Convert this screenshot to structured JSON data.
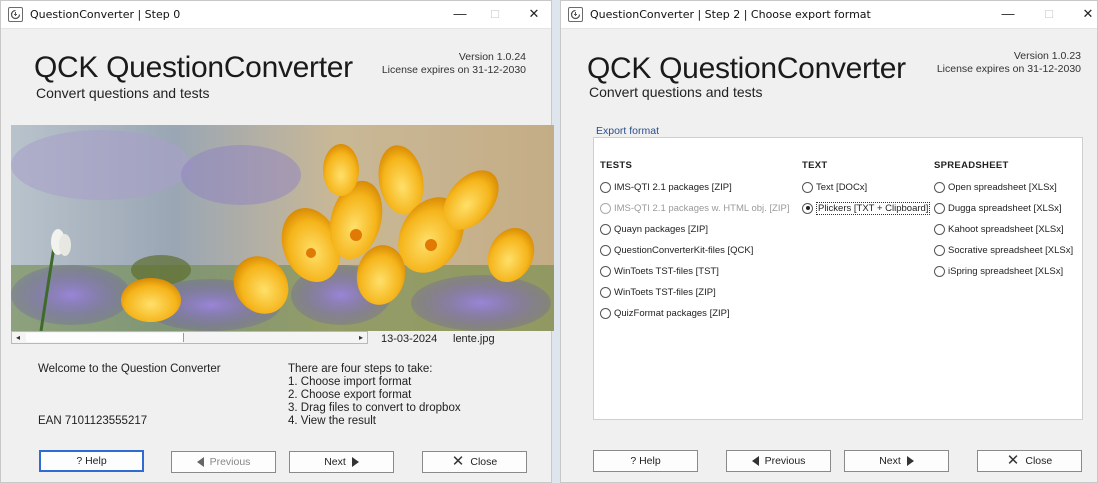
{
  "left": {
    "title": "QuestionConverter | Step 0",
    "controls": {
      "minimize": "—",
      "maximize": "□",
      "close": "✕"
    },
    "brand": "QCK QuestionConverter",
    "subtitle": "Convert questions and tests",
    "version": "Version 1.0.24",
    "license": "License expires on 31-12-2030",
    "image_date": "13-03-2024",
    "image_name": "lente.jpg",
    "welcome": "Welcome to the Question Converter",
    "ean": "EAN 7101123555217",
    "steps": [
      "There are four steps to take:",
      "1. Choose import format",
      "2. Choose export format",
      "3. Drag files to convert to dropbox",
      "4. View the result"
    ],
    "buttons": {
      "help": "? Help",
      "previous": "Previous",
      "next": "Next",
      "close": "Close"
    }
  },
  "right": {
    "title": "QuestionConverter | Step 2 | Choose export format",
    "controls": {
      "minimize": "—",
      "maximize": "□",
      "close": "✕"
    },
    "brand": "QCK QuestionConverter",
    "subtitle": "Convert questions and tests",
    "version": "Version 1.0.23",
    "license": "License expires on 31-12-2030",
    "section": "Export format",
    "columns": {
      "tests": {
        "heading": "TESTS",
        "options": [
          "IMS-QTI 2.1 packages [ZIP]",
          "IMS-QTI 2.1 packages w. HTML obj. [ZIP]",
          "Quayn packages [ZIP]",
          "QuestionConverterKit-files [QCK]",
          "WinToets TST-files [TST]",
          "WinToets TST-files [ZIP]",
          "QuizFormat packages [ZIP]"
        ]
      },
      "text": {
        "heading": "TEXT",
        "options": [
          "Text [DOCx]",
          "Plickers [TXT + Clipboard]"
        ]
      },
      "spreadsheet": {
        "heading": "SPREADSHEET",
        "options": [
          "Open spreadsheet [XLSx]",
          "Dugga spreadsheet [XLSx]",
          "Kahoot spreadsheet [XLSx]",
          "Socrative spreadsheet [XLSx]",
          "iSpring spreadsheet [XLSx]"
        ]
      }
    },
    "selected_option": "Plickers [TXT + Clipboard]",
    "buttons": {
      "help": "? Help",
      "previous": "Previous",
      "next": "Next",
      "close": "Close"
    }
  }
}
